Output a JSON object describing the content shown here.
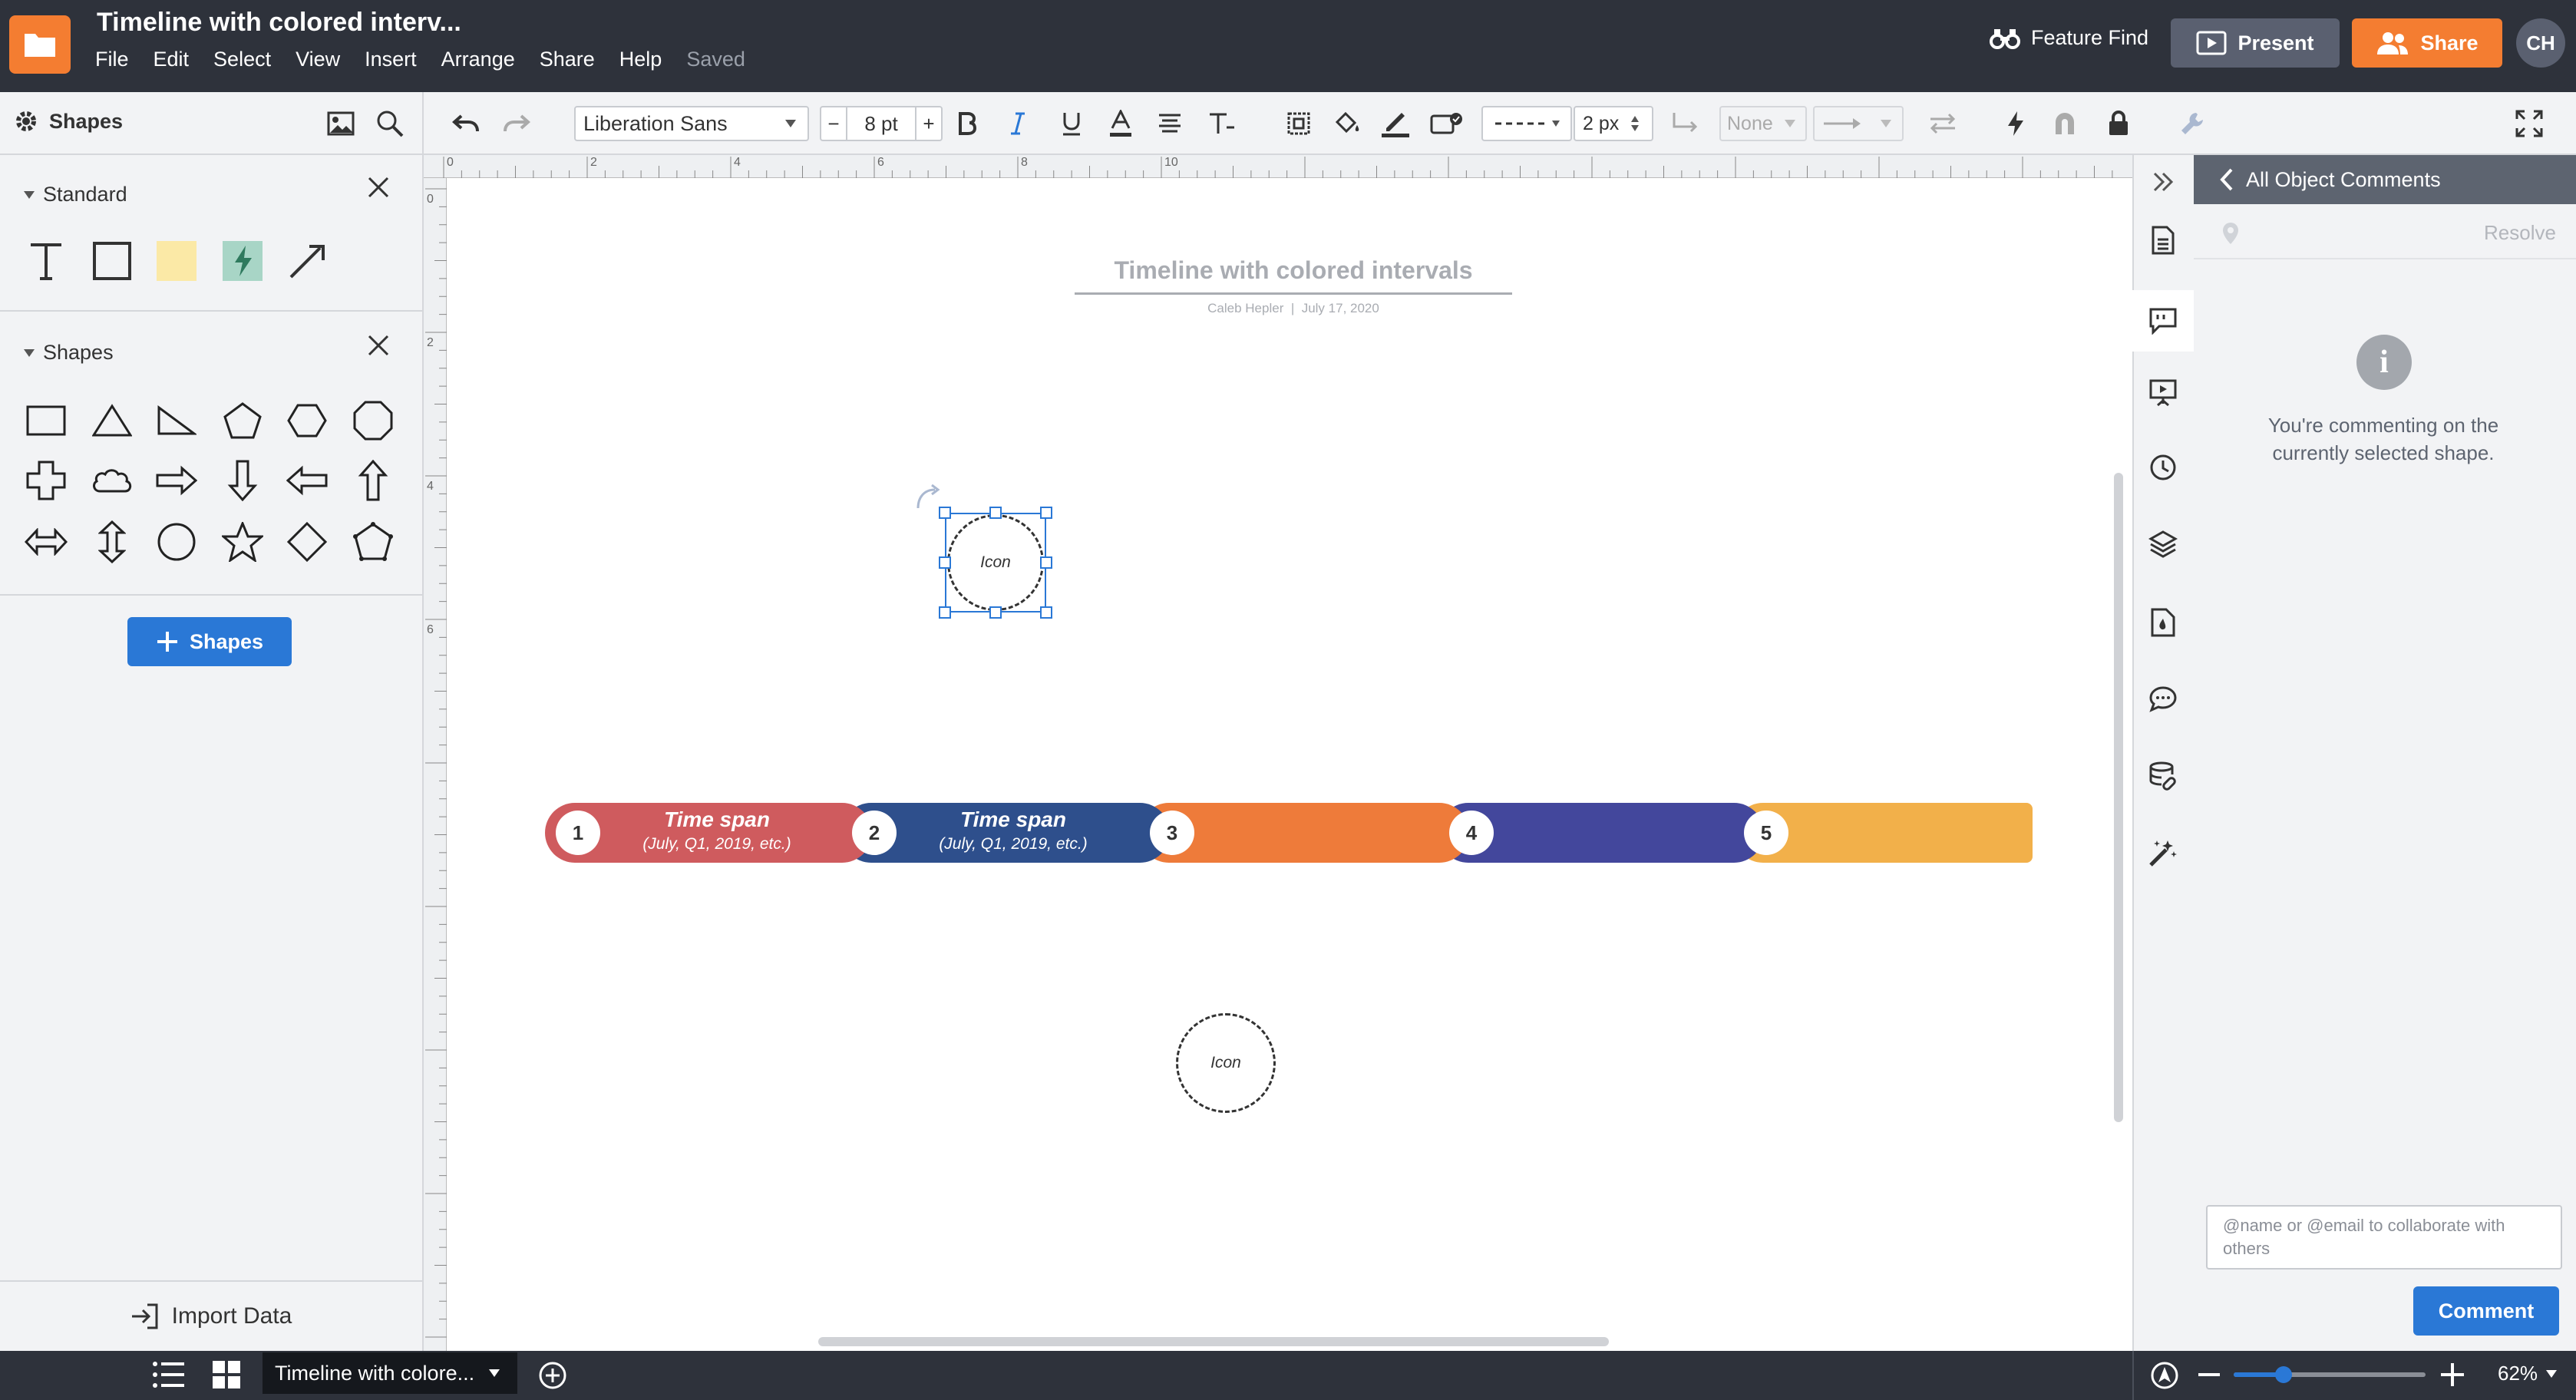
{
  "header": {
    "doc_title": "Timeline with colored interv...",
    "menu": [
      "File",
      "Edit",
      "Select",
      "View",
      "Insert",
      "Arrange",
      "Share",
      "Help"
    ],
    "saved_status": "Saved",
    "feature_find": "Feature Find",
    "present_label": "Present",
    "share_label": "Share",
    "avatar_initials": "CH"
  },
  "toolbar": {
    "shapes_label": "Shapes",
    "font_family": "Liberation Sans",
    "font_size": "8 pt",
    "size_minus": "−",
    "size_plus": "+",
    "line_width": "2 px",
    "arrow_start": "None"
  },
  "left_panel": {
    "standard_title": "Standard",
    "shapes_title": "Shapes",
    "add_shapes_label": "Shapes",
    "import_data_label": "Import Data"
  },
  "ruler": {
    "top_labels": [
      "0",
      "2",
      "4",
      "6",
      "8",
      "10"
    ],
    "left_labels": [
      "0",
      "2",
      "4",
      "6"
    ]
  },
  "canvas": {
    "title": "Timeline with colored intervals",
    "author": "Caleb Hepler",
    "separator": "|",
    "date": "July 17, 2020",
    "icon_label_1": "Icon",
    "icon_label_2": "Icon",
    "timeline": [
      {
        "number": "1",
        "title": "Time span",
        "subtitle": "(July, Q1, 2019, etc.)",
        "color": "#cf5b5e"
      },
      {
        "number": "2",
        "title": "Time span",
        "subtitle": "(July, Q1, 2019, etc.)",
        "color": "#2e4f8c"
      },
      {
        "number": "3",
        "title": "",
        "subtitle": "",
        "color": "#ee7b3a"
      },
      {
        "number": "4",
        "title": "",
        "subtitle": "",
        "color": "#43479c"
      },
      {
        "number": "5",
        "title": "",
        "subtitle": "",
        "color": "#f2b04a"
      }
    ]
  },
  "comments": {
    "header": "All Object Comments",
    "resolve": "Resolve",
    "info_icon": "i",
    "info_text": "You're commenting on the currently selected shape.",
    "input_placeholder": "@name or @email to collaborate with others",
    "comment_button": "Comment"
  },
  "bottom": {
    "page_tab": "Timeline with colore...",
    "zoom": "62%",
    "zoom_fraction": 0.26
  },
  "colors": {
    "brand_orange": "#f47d31",
    "accent_blue": "#2a78d6",
    "header_dark": "#2e323b"
  }
}
